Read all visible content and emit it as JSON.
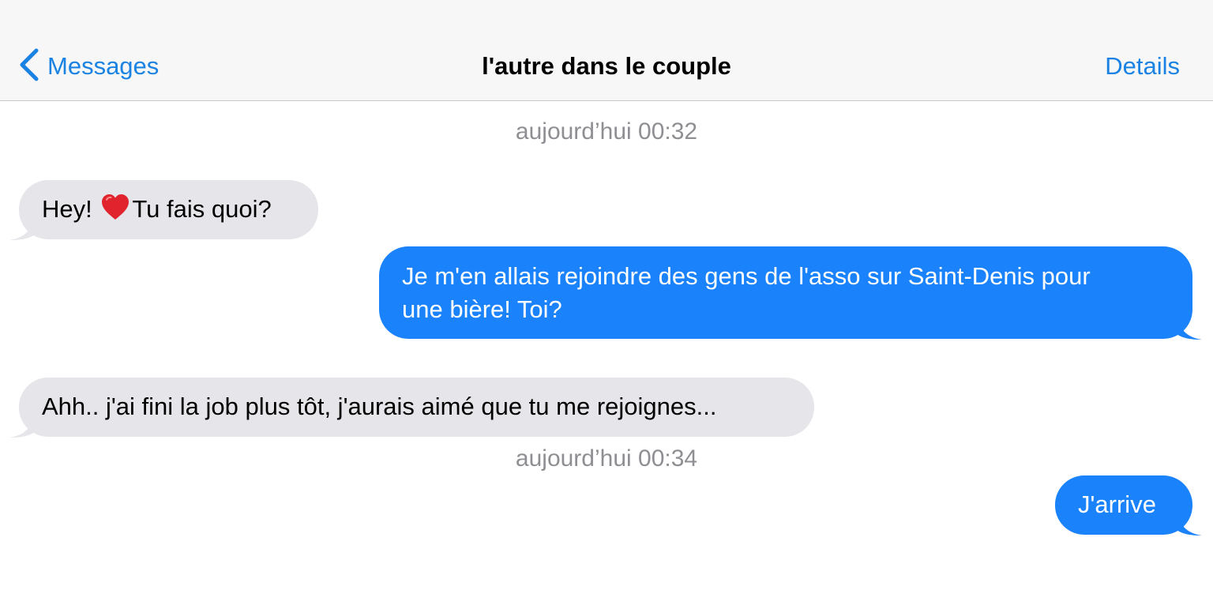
{
  "nav": {
    "back_label": "Messages",
    "title": "l'autre dans le couple",
    "details_label": "Details"
  },
  "timestamps": [
    "aujourd’hui 00:32",
    "aujourd’hui 00:34"
  ],
  "messages": [
    {
      "direction": "incoming",
      "text_before": "Hey! ",
      "emoji": "red-heart",
      "text_after": "Tu fais quoi?"
    },
    {
      "direction": "outgoing",
      "line1": "Je m'en allais rejoindre des gens de l'asso sur Saint-Denis pour",
      "line2": "une bière! Toi?"
    },
    {
      "direction": "incoming",
      "text": "Ahh.. j'ai fini la job plus tôt, j'aurais aimé que tu me rejoignes..."
    },
    {
      "direction": "outgoing",
      "text": "J'arrive"
    }
  ],
  "colors": {
    "accent": "#1a82e2",
    "outgoing_bubble": "#1a82fb",
    "incoming_bubble": "#e5e5ea",
    "timestamp": "#8e8e93"
  }
}
